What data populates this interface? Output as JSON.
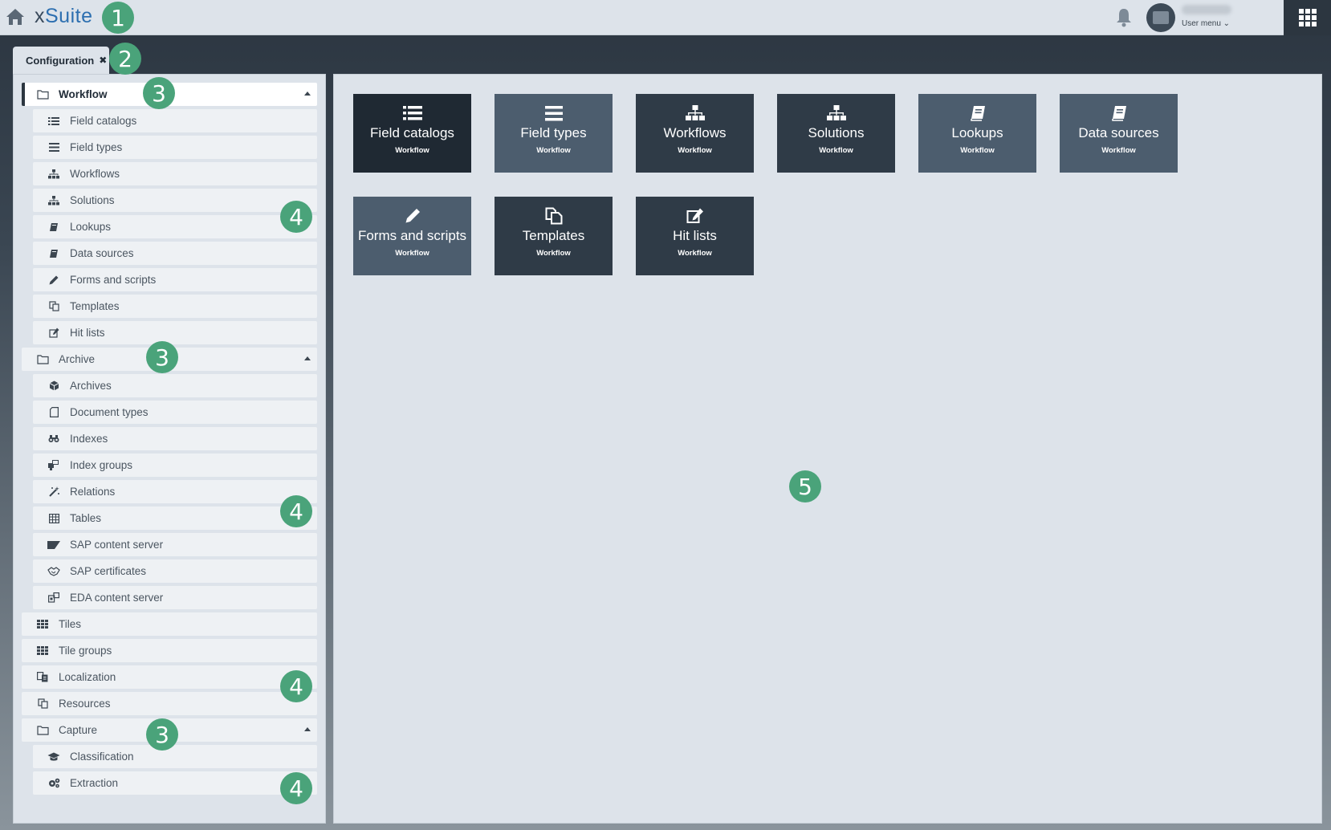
{
  "header": {
    "brand_prefix": "x",
    "brand_suffix": "Suite",
    "user_menu_label": "User menu ⌄"
  },
  "tab": {
    "label": "Configuration",
    "close": "✖"
  },
  "badges": {
    "b1": "1",
    "b2": "2",
    "b3": "3",
    "b4": "4",
    "b5": "5"
  },
  "sidebar": {
    "workflow": {
      "label": "Workflow",
      "items": [
        "Field catalogs",
        "Field types",
        "Workflows",
        "Solutions",
        "Lookups",
        "Data sources",
        "Forms and scripts",
        "Templates",
        "Hit lists"
      ]
    },
    "archive": {
      "label": "Archive",
      "items": [
        "Archives",
        "Document types",
        "Indexes",
        "Index groups",
        "Relations",
        "Tables",
        "SAP content server",
        "SAP certificates",
        "EDA content server"
      ]
    },
    "standalone": [
      "Tiles",
      "Tile groups",
      "Localization",
      "Resources"
    ],
    "capture": {
      "label": "Capture",
      "items": [
        "Classification",
        "Extraction"
      ]
    }
  },
  "tiles": [
    {
      "title": "Field catalogs",
      "sub": "Workflow",
      "icon": "list-icon"
    },
    {
      "title": "Field types",
      "sub": "Workflow",
      "icon": "bars-icon"
    },
    {
      "title": "Workflows",
      "sub": "Workflow",
      "icon": "sitemap-icon"
    },
    {
      "title": "Solutions",
      "sub": "Workflow",
      "icon": "sitemap-icon"
    },
    {
      "title": "Lookups",
      "sub": "Workflow",
      "icon": "book-icon"
    },
    {
      "title": "Data sources",
      "sub": "Workflow",
      "icon": "book-icon"
    },
    {
      "title": "Forms and scripts",
      "sub": "Workflow",
      "icon": "pencil-icon"
    },
    {
      "title": "Templates",
      "sub": "Workflow",
      "icon": "copy-icon"
    },
    {
      "title": "Hit lists",
      "sub": "Workflow",
      "icon": "edit-icon"
    }
  ],
  "colors": {
    "tile_dark": "#2f3b47",
    "tile_slate": "#4c5d6e",
    "badge": "#4aa37a",
    "brand": "#2d6fb0"
  }
}
